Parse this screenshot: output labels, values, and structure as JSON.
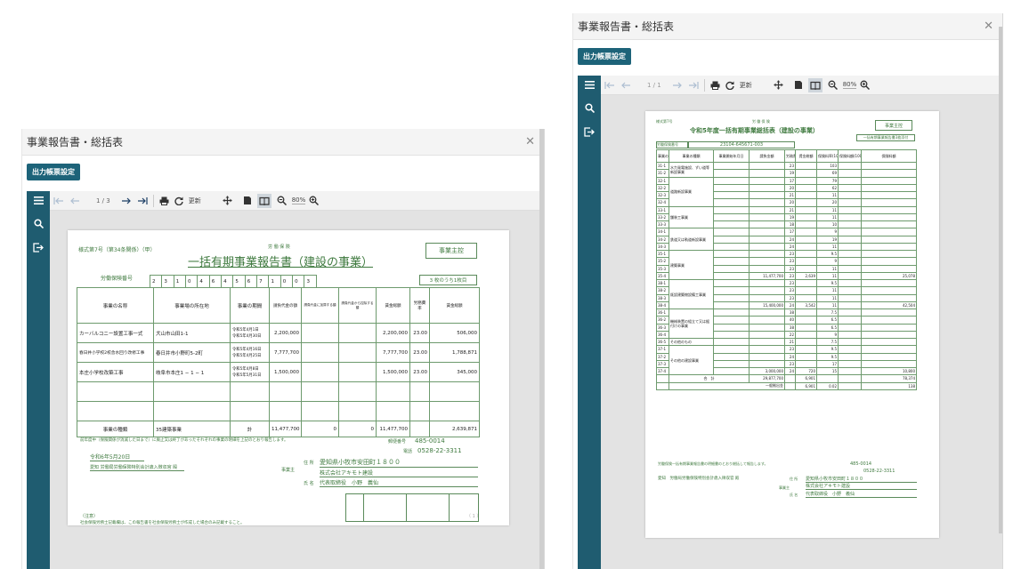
{
  "app": {
    "title": "事業報告書・総括表",
    "output_btn": "出力帳票設定"
  },
  "toolbar": {
    "page_indicator_1": "1 / 3",
    "page_indicator_2": "1 / 1",
    "refresh": "更新",
    "zoom": "80%"
  },
  "icons": [
    "first-page-icon",
    "prev-page-icon",
    "next-page-icon",
    "last-page-icon",
    "print-icon",
    "refresh-icon",
    "move-icon",
    "single-page-icon",
    "two-page-icon",
    "zoom-out-icon",
    "zoom-in-icon",
    "menu-icon",
    "search-icon",
    "exit-icon",
    "close-icon"
  ],
  "accent": "#1d6379",
  "report1": {
    "form_no": "様式第7号（第34条関係）（甲）",
    "sub_label": "労 働 保 険",
    "title": "一括有期事業報告書（建設の事業）",
    "business_box": "事業主控",
    "ins_no_label": "労働保険番号",
    "ins_no_digits": [
      "2",
      "3",
      "1",
      "0",
      "4",
      "6",
      "4",
      "5",
      "6",
      "7",
      "1",
      "0",
      "0",
      "3"
    ],
    "sheet_count": "3 枚のうち1枚目",
    "headers": {
      "name": "事業の名称",
      "place": "事業場の所在地",
      "period": "事業の期間",
      "amount": "請負代金の額",
      "amount_a": "請負代金に加算する額",
      "amount_b": "請負代金から控除する額",
      "labor_cost": "賃金総額",
      "rate": "労務費率",
      "total_wage": "賃金総額"
    },
    "rows": [
      {
        "name": "カーバルコニー設置工事一式",
        "place": "犬山市山田1-1",
        "period1": "令和5年4月1日",
        "period2": "令和5年4月30日",
        "amount": "2,200,000",
        "cost": "2,200,000",
        "rate": "23.00",
        "wage": "506,000"
      },
      {
        "name": "春日井小学校2校舎水回り改修工事",
        "place": "春日井市小野町5-2町",
        "period1": "令和5年4月16日",
        "period2": "令和5年4月25日",
        "amount": "7,777,700",
        "cost": "7,777,700",
        "rate": "23.00",
        "wage": "1,788,871"
      },
      {
        "name": "本庄小学校改築工事",
        "place": "岐阜市本庄1 − 1 − 1",
        "period1": "令和5年4月8日",
        "period2": "令和5年5月31日",
        "amount": "1,500,000",
        "cost": "1,500,000",
        "rate": "23.00",
        "wage": "345,000"
      }
    ],
    "kind_label": "事業の種類",
    "kind_value": "35建築事業",
    "total_label": "計",
    "totals": {
      "amount": "11,477,700",
      "a": "0",
      "b": "0",
      "cost": "11,477,700",
      "wage": "2,639,871"
    },
    "note": "前年度中（保険関係が消滅した日まで）に廃止又は終了があったそれぞれの事業の明細を上記のとおり報告します。",
    "postal_label": "郵便番号",
    "postal": "485-0014",
    "tel_label": "電話",
    "tel": "0528-22-3311",
    "date": "令和6年5月20日",
    "office": "愛知 労働局労働保険特別会計歳入徴収官 殿",
    "addr_label": "住 所",
    "addr": "愛知県小牧市安田町１８００",
    "employer_label": "事業主",
    "corp": "株式会社アキモト建設",
    "name_label": "氏 名",
    "rep": "代表取締役　小野　義仙",
    "note_head": "（注意）",
    "note_body": "社会保険労務士記載欄は、この報告書を社会保険労務士が作成した場合のみ記載すること。",
    "page_footer": "（ 1 ）"
  },
  "report2": {
    "form_no": "様式第7号",
    "sub_label": "労 働 保 険",
    "title": "令和5年度一括有期事業総括表（建設の事業）",
    "business_box": "事業主控",
    "attach_box": "一括有期事業報告書3枚添付",
    "ins_no_label": "労働保険番号",
    "ins_no": "23104-645671-003",
    "headers": [
      "事業の種類",
      "事業の種類",
      "事業開始年月日",
      "請負金額",
      "労務費率",
      "賃金総額",
      "保険料率(1000分の)",
      "保険料額(1000分の)",
      "保険料額"
    ],
    "categories": [
      "水力発電施設、ずい道等新設事業",
      "道路新設事業",
      "舗装工事業",
      "鉄道又は軌道新設事業",
      "建築事業",
      "既設建築物設備工事業",
      "機械装置の組立て又は据付けの事業",
      "その他のもの",
      "その他の建設事業"
    ],
    "codes": [
      "31-1",
      "31-2",
      "32-1",
      "32-2",
      "32-3",
      "32-4",
      "33-1",
      "33-2",
      "33-3",
      "34-1",
      "34-2",
      "34-3",
      "35-1",
      "35-2",
      "35-3",
      "35-4",
      "38-1",
      "38-2",
      "38-3",
      "38-4",
      "36-1",
      "36-2",
      "36-3",
      "36-4",
      "36-5",
      "37-1",
      "37-2",
      "37-3",
      "37-4"
    ],
    "rates": [
      "23",
      "19",
      "17",
      "20",
      "21",
      "20",
      "21",
      "19",
      "18",
      "17",
      "24",
      "24",
      "23",
      "23",
      "23",
      "23",
      "23",
      "23",
      "23",
      "24",
      "38",
      "40",
      "38",
      "22",
      "21",
      "23",
      "24",
      "23",
      "24"
    ],
    "pct": [
      "103",
      "69",
      "79",
      "62",
      "11",
      "20",
      "11",
      "11",
      "10",
      "9",
      "19",
      "11",
      "9.5",
      "9",
      "11",
      "11",
      "9.5",
      "11",
      "11",
      "11",
      "7.5",
      "6.5",
      "6.5",
      "9",
      "7.5",
      "9.5",
      "9.5",
      "17",
      "15"
    ],
    "row_3504": {
      "amount": "11,477,700",
      "rate": "23",
      "wage": "2,639",
      "pct": "9.5",
      "premium": "25,078"
    },
    "row_3804": {
      "amount": "15,400,000",
      "rate": "23",
      "wage": "3,542",
      "pct": "12",
      "premium": "42,504"
    },
    "row_3704": {
      "amount": "3,000,000",
      "rate": "24",
      "wage": "720",
      "pct": "15",
      "premium": "10,800"
    },
    "sum_label": "合　計",
    "sum": {
      "amount": "29,877,700",
      "wage": "6,901",
      "premium": "78,374"
    },
    "sum2_label": "一般拠出金",
    "sum2": {
      "wage": "6,901",
      "pct": "0.02",
      "premium": "138"
    },
    "note": "労働保険一括有期事業報告書の明細書のとおり総括して報告します。",
    "postal": "485-0014",
    "tel": "0528-22-3311",
    "office": "愛知　労働局労働保険特別会計歳入徴収官 殿",
    "addr": "愛知県小牧市安田町１８００",
    "corp": "株式会社アキモト建設",
    "rep": "代表取締役　小野　義仙",
    "employer_label": "事業主",
    "addr_label": "住 所",
    "name_label": "氏 名"
  }
}
